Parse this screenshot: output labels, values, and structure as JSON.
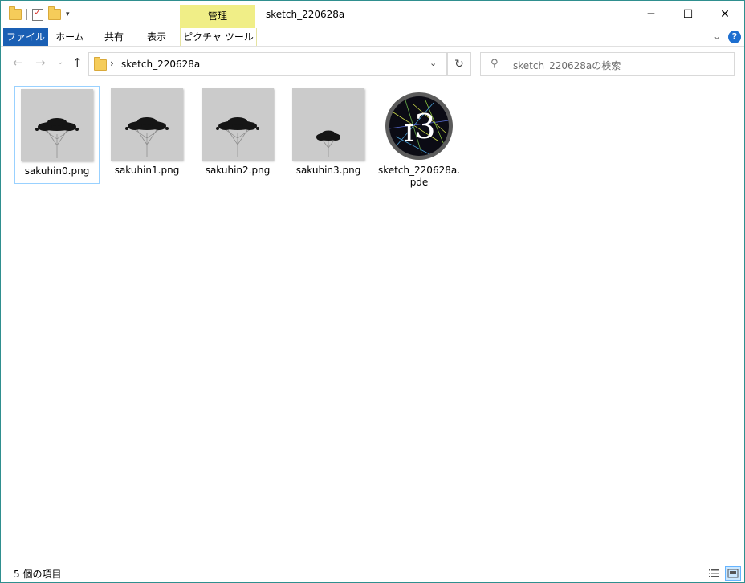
{
  "window": {
    "title": "sketch_220628a",
    "context_tab": "管理",
    "controls": {
      "minimize": "─",
      "maximize": "☐",
      "close": "✕"
    }
  },
  "ribbon": {
    "tabs": [
      "ファイル",
      "ホーム",
      "共有",
      "表示",
      "ピクチャ ツール"
    ],
    "help": "?"
  },
  "address": {
    "path": "sketch_220628a",
    "separator": "›"
  },
  "search": {
    "placeholder": "sketch_220628aの検索"
  },
  "files": [
    {
      "name": "sakuhin0.png",
      "type": "image",
      "selected": true
    },
    {
      "name": "sakuhin1.png",
      "type": "image",
      "selected": false
    },
    {
      "name": "sakuhin2.png",
      "type": "image",
      "selected": false
    },
    {
      "name": "sakuhin3.png",
      "type": "image",
      "selected": false
    },
    {
      "name": "sketch_220628a.pde",
      "type": "processing-sketch",
      "selected": false
    }
  ],
  "status": {
    "item_count": "5 個の項目"
  },
  "colors": {
    "accent": "#1a5fb4",
    "context_tab": "#f0ee87",
    "selection_border": "#99d1ff",
    "thumbnail_bg": "#cbcbcb"
  }
}
